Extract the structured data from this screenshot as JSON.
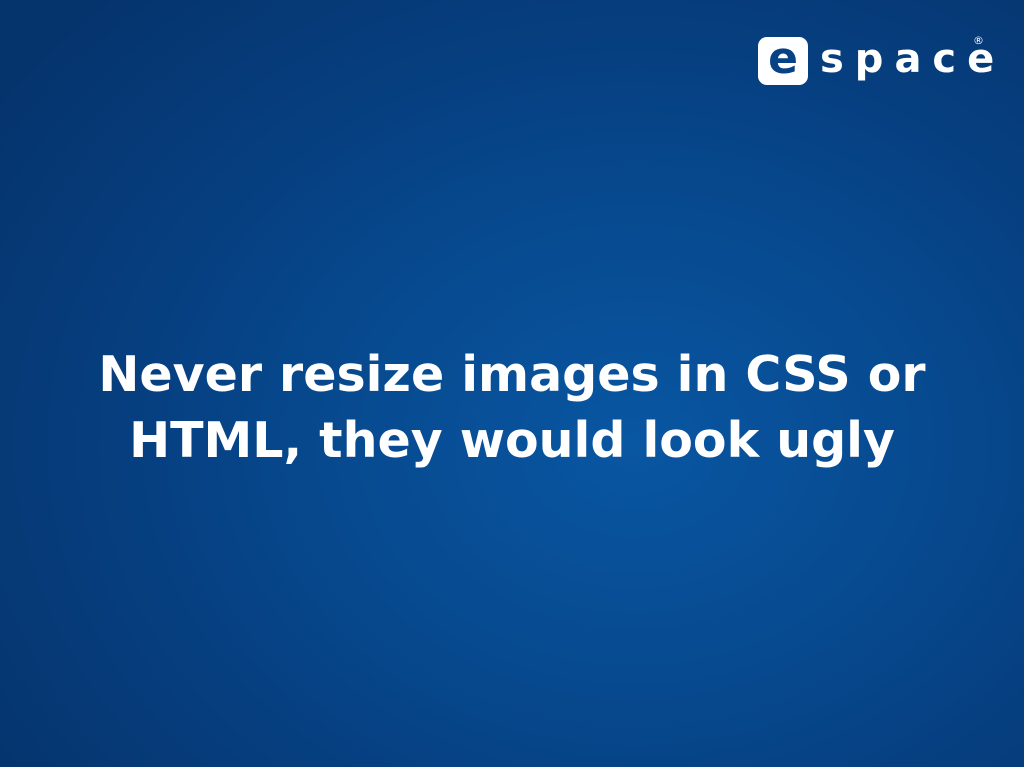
{
  "logo": {
    "letter": "e",
    "word": "space",
    "registered": "®"
  },
  "slide": {
    "lines": [
      "Never resize images in CSS or",
      "HTML, they would look ugly"
    ]
  },
  "colors": {
    "background": "#064a90",
    "text": "#ffffff",
    "logo_letter": "#064285"
  }
}
